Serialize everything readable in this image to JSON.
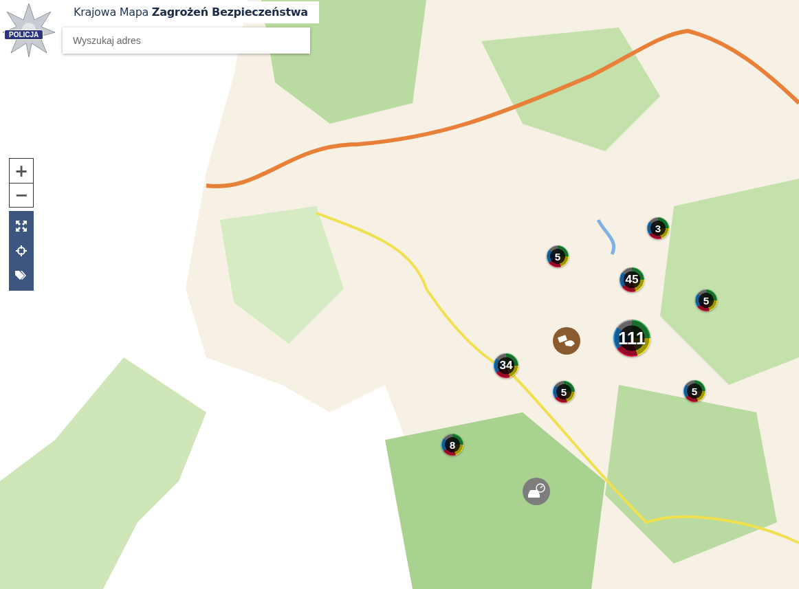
{
  "logo": {
    "text": "POLICJA"
  },
  "header": {
    "title": "Krajowa Mapa **Zagrożeń Bezpieczeństwa**"
  },
  "search": {
    "placeholder": "Wyszukaj adres"
  },
  "zoom_controls": [
    "+",
    "−"
  ],
  "clusters": [
    {
      "count": "3"
    },
    {
      "count": "5"
    },
    {
      "count": "45"
    },
    {
      "count": "5"
    },
    {
      "count": "111"
    },
    {
      "count": "34"
    },
    {
      "count": "5"
    },
    {
      "count": "5"
    },
    {
      "count": "8"
    }
  ]
}
